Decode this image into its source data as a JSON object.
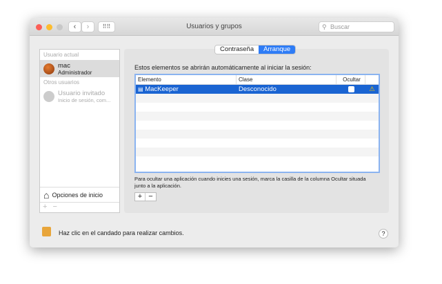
{
  "window": {
    "title": "Usuarios y grupos",
    "search_placeholder": "Buscar"
  },
  "sidebar": {
    "current_label": "Usuario actual",
    "current_user": {
      "name": "mac",
      "role": "Administrador"
    },
    "others_label": "Otros usuarios",
    "guest": {
      "name": "Usuario invitado",
      "detail": "Inicio de sesión, com..."
    },
    "login_options": "Opciones de inicio",
    "add": "+",
    "remove": "−"
  },
  "tabs": [
    {
      "label": "Contraseña",
      "active": false
    },
    {
      "label": "Arranque",
      "active": true
    }
  ],
  "main": {
    "heading": "Estos elementos se abrirán automáticamente al iniciar la sesión:",
    "columns": [
      "Elemento",
      "Clase",
      "Ocultar"
    ],
    "rows": [
      {
        "element": "MacKeeper",
        "class": "Desconocido",
        "hidden": false,
        "warning": true
      }
    ],
    "hint": "Para ocultar una aplicación cuando inicies una sesión, marca la casilla de la columna Ocultar situada junto a la aplicación.",
    "add": "+",
    "remove": "−"
  },
  "footer": {
    "lock_text": "Haz clic en el candado para realizar cambios.",
    "help": "?"
  },
  "colors": {
    "accent": "#1a64d2"
  }
}
